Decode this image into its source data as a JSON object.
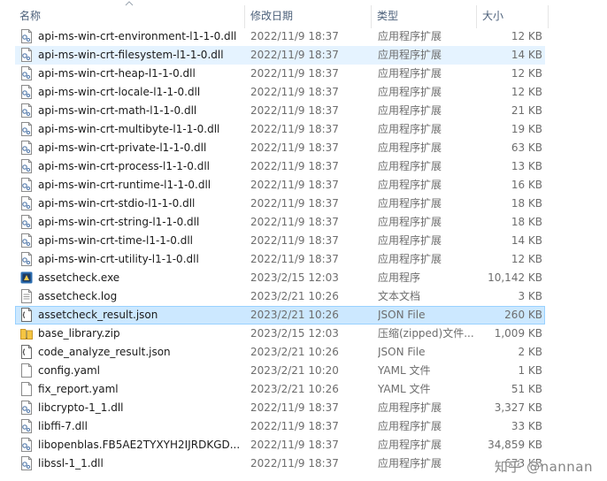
{
  "columns": {
    "name": "名称",
    "date": "修改日期",
    "type": "类型",
    "size": "大小"
  },
  "files": [
    {
      "name": "api-ms-win-crt-environment-l1-1-0.dll",
      "date": "2022/11/9 18:37",
      "type": "应用程序扩展",
      "size": "12 KB",
      "icon": "dll-icon",
      "state": ""
    },
    {
      "name": "api-ms-win-crt-filesystem-l1-1-0.dll",
      "date": "2022/11/9 18:37",
      "type": "应用程序扩展",
      "size": "14 KB",
      "icon": "dll-icon",
      "state": "hover"
    },
    {
      "name": "api-ms-win-crt-heap-l1-1-0.dll",
      "date": "2022/11/9 18:37",
      "type": "应用程序扩展",
      "size": "12 KB",
      "icon": "dll-icon",
      "state": ""
    },
    {
      "name": "api-ms-win-crt-locale-l1-1-0.dll",
      "date": "2022/11/9 18:37",
      "type": "应用程序扩展",
      "size": "12 KB",
      "icon": "dll-icon",
      "state": ""
    },
    {
      "name": "api-ms-win-crt-math-l1-1-0.dll",
      "date": "2022/11/9 18:37",
      "type": "应用程序扩展",
      "size": "21 KB",
      "icon": "dll-icon",
      "state": ""
    },
    {
      "name": "api-ms-win-crt-multibyte-l1-1-0.dll",
      "date": "2022/11/9 18:37",
      "type": "应用程序扩展",
      "size": "19 KB",
      "icon": "dll-icon",
      "state": ""
    },
    {
      "name": "api-ms-win-crt-private-l1-1-0.dll",
      "date": "2022/11/9 18:37",
      "type": "应用程序扩展",
      "size": "63 KB",
      "icon": "dll-icon",
      "state": ""
    },
    {
      "name": "api-ms-win-crt-process-l1-1-0.dll",
      "date": "2022/11/9 18:37",
      "type": "应用程序扩展",
      "size": "13 KB",
      "icon": "dll-icon",
      "state": ""
    },
    {
      "name": "api-ms-win-crt-runtime-l1-1-0.dll",
      "date": "2022/11/9 18:37",
      "type": "应用程序扩展",
      "size": "16 KB",
      "icon": "dll-icon",
      "state": ""
    },
    {
      "name": "api-ms-win-crt-stdio-l1-1-0.dll",
      "date": "2022/11/9 18:37",
      "type": "应用程序扩展",
      "size": "18 KB",
      "icon": "dll-icon",
      "state": ""
    },
    {
      "name": "api-ms-win-crt-string-l1-1-0.dll",
      "date": "2022/11/9 18:37",
      "type": "应用程序扩展",
      "size": "18 KB",
      "icon": "dll-icon",
      "state": ""
    },
    {
      "name": "api-ms-win-crt-time-l1-1-0.dll",
      "date": "2022/11/9 18:37",
      "type": "应用程序扩展",
      "size": "14 KB",
      "icon": "dll-icon",
      "state": ""
    },
    {
      "name": "api-ms-win-crt-utility-l1-1-0.dll",
      "date": "2022/11/9 18:37",
      "type": "应用程序扩展",
      "size": "12 KB",
      "icon": "dll-icon",
      "state": ""
    },
    {
      "name": "assetcheck.exe",
      "date": "2023/2/15 12:03",
      "type": "应用程序",
      "size": "10,142 KB",
      "icon": "exe-icon",
      "state": ""
    },
    {
      "name": "assetcheck.log",
      "date": "2023/2/21 10:26",
      "type": "文本文档",
      "size": "3 KB",
      "icon": "text-file-icon",
      "state": ""
    },
    {
      "name": "assetcheck_result.json",
      "date": "2023/2/21 10:26",
      "type": "JSON File",
      "size": "260 KB",
      "icon": "json-file-icon",
      "state": "selected"
    },
    {
      "name": "base_library.zip",
      "date": "2023/2/15 12:03",
      "type": "压缩(zipped)文件...",
      "size": "1,009 KB",
      "icon": "zip-folder-icon",
      "state": ""
    },
    {
      "name": "code_analyze_result.json",
      "date": "2023/2/21 10:26",
      "type": "JSON File",
      "size": "2 KB",
      "icon": "json-file-icon",
      "state": ""
    },
    {
      "name": "config.yaml",
      "date": "2023/2/21 10:20",
      "type": "YAML 文件",
      "size": "1 KB",
      "icon": "blank-file-icon",
      "state": ""
    },
    {
      "name": "fix_report.yaml",
      "date": "2023/2/21 10:26",
      "type": "YAML 文件",
      "size": "51 KB",
      "icon": "blank-file-icon",
      "state": ""
    },
    {
      "name": "libcrypto-1_1.dll",
      "date": "2022/11/9 18:37",
      "type": "应用程序扩展",
      "size": "3,327 KB",
      "icon": "dll-icon",
      "state": ""
    },
    {
      "name": "libffi-7.dll",
      "date": "2022/11/9 18:37",
      "type": "应用程序扩展",
      "size": "33 KB",
      "icon": "dll-icon",
      "state": ""
    },
    {
      "name": "libopenblas.FB5AE2TYXYH2IJRDKGD...",
      "date": "2022/11/9 18:37",
      "type": "应用程序扩展",
      "size": "34,859 KB",
      "icon": "dll-icon",
      "state": ""
    },
    {
      "name": "libssl-1_1.dll",
      "date": "2022/11/9 18:37",
      "type": "应用程序扩展",
      "size": "673 KB",
      "icon": "dll-icon",
      "state": ""
    }
  ],
  "watermark": "知乎 @nannan",
  "colors": {
    "selected_bg": "#cce8ff",
    "selected_border": "#99d1ff",
    "hover_bg": "#e5f3ff",
    "header_text": "#4c607a",
    "secondary_text": "#6d6d6d"
  }
}
